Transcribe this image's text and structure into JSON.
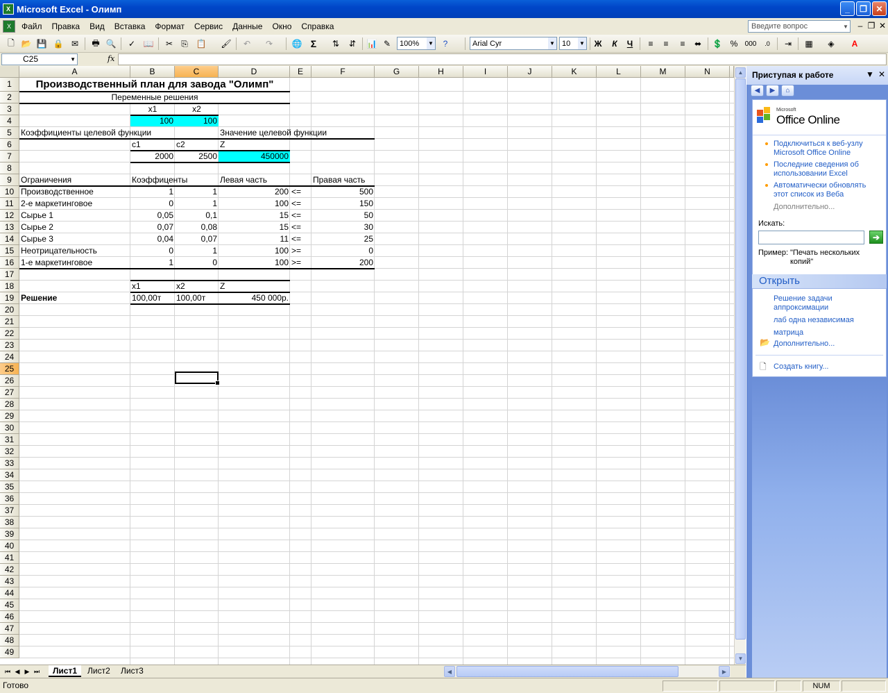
{
  "window": {
    "title": "Microsoft Excel - Олимп",
    "app_icon": "X"
  },
  "menu": {
    "items": [
      "Файл",
      "Правка",
      "Вид",
      "Вставка",
      "Формат",
      "Сервис",
      "Данные",
      "Окно",
      "Справка"
    ],
    "ask_placeholder": "Введите вопрос"
  },
  "toolbar": {
    "zoom": "100%",
    "font": "Arial Cyr",
    "size": "10",
    "bold": "Ж",
    "italic": "К",
    "underline": "Ч",
    "percent": "%",
    "thousands": "000",
    "sigma": "Σ",
    "font_color_glyph": "A",
    "font_color": "#ff0000"
  },
  "formula": {
    "namebox": "C25",
    "fx": "fx",
    "value": ""
  },
  "columns": [
    "A",
    "B",
    "C",
    "D",
    "E",
    "F",
    "G",
    "H",
    "I",
    "J",
    "K",
    "L",
    "M",
    "N"
  ],
  "rows": [
    "1",
    "2",
    "3",
    "4",
    "5",
    "6",
    "7",
    "8",
    "9",
    "10",
    "11",
    "12",
    "13",
    "14",
    "15",
    "16",
    "17",
    "18",
    "19",
    "20",
    "21",
    "22",
    "23",
    "24",
    "25",
    "26",
    "27",
    "28",
    "29",
    "30",
    "31",
    "32",
    "33",
    "34",
    "35",
    "36",
    "37",
    "38",
    "39",
    "40",
    "41",
    "42",
    "43",
    "44",
    "45",
    "46",
    "47",
    "48",
    "49"
  ],
  "sheet": {
    "title": "Производственный план для завода \"Олимп\"",
    "vars_header": "Переменные решения",
    "x1": "x1",
    "x2": "x2",
    "x1_val": "100",
    "x2_val": "100",
    "coef_header": "Коэффициенты целевой функции",
    "obj_header": "Значение целевой функции",
    "c1": "c1",
    "c2": "c2",
    "z": "Z",
    "c1_val": "2000",
    "c2_val": "2500",
    "z_val": "450000",
    "constraints_label": "Ограничения",
    "coefs_label": "Коэффиценты",
    "lhs_label": "Левая часть",
    "rhs_label": "Правая часть",
    "constraints": [
      {
        "name": "Производственное",
        "b": "1",
        "c": "1",
        "d": "200",
        "e": "<=",
        "f": "500"
      },
      {
        "name": "2-е маркетинговое",
        "b": "0",
        "c": "1",
        "d": "100",
        "e": "<=",
        "f": "150"
      },
      {
        "name": "Сырье 1",
        "b": "0,05",
        "c": "0,1",
        "d": "15",
        "e": "<=",
        "f": "50"
      },
      {
        "name": "Сырье 2",
        "b": "0,07",
        "c": "0,08",
        "d": "15",
        "e": "<=",
        "f": "30"
      },
      {
        "name": "Сырье 3",
        "b": "0,04",
        "c": "0,07",
        "d": "11",
        "e": "<=",
        "f": "25"
      },
      {
        "name": "Неотрицательность",
        "b": "0",
        "c": "1",
        "d": "100",
        "e": ">=",
        "f": "0"
      },
      {
        "name": "1-е маркетинговое",
        "b": "1",
        "c": "0",
        "d": "100",
        "e": ">=",
        "f": "200"
      }
    ],
    "sol_x1": "x1",
    "sol_x2": "x2",
    "sol_z": "Z",
    "solution_label": "Решение",
    "sol_x1_val": "100,00т",
    "sol_x2_val": "100,00т",
    "sol_z_val": "450 000р."
  },
  "tabs": [
    "Лист1",
    "Лист2",
    "Лист3"
  ],
  "status": {
    "text": "Готово",
    "num": "NUM"
  },
  "taskpane": {
    "title": "Приступая к работе",
    "logo_small": "Microsoft",
    "logo": "Office Online",
    "links": [
      "Подключиться к веб-узлу Microsoft Office Online",
      "Последние сведения об использовании Excel",
      "Автоматически обновлять этот список из Веба"
    ],
    "more": "Дополнительно...",
    "search_label": "Искать:",
    "example_label": "Пример:",
    "example_text": "\"Печать нескольких копий\"",
    "open_header": "Открыть",
    "open_files": [
      "Решение задачи аппроксимации",
      "лаб одна независимая",
      "матрица"
    ],
    "open_more": "Дополнительно...",
    "create": "Создать книгу..."
  },
  "colors": {
    "highlight": "#00ffff",
    "title_bar": "#0046c8",
    "selected_header": "#f7b352"
  }
}
